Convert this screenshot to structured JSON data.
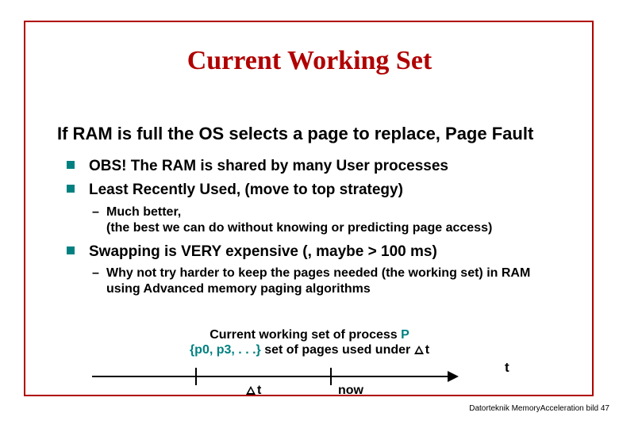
{
  "title": "Current Working Set",
  "intro": "If RAM is full the OS selects a page to replace, Page Fault",
  "bullets": {
    "b1": "OBS! The RAM is shared by many User processes",
    "b2": "Least Recently Used, (move to top strategy)",
    "b2_sub1a": "Much better,",
    "b2_sub1b": "(the best we can do without knowing or predicting page access)",
    "b3": "Swapping is VERY expensive (, maybe > 100 ms)",
    "b3_sub1a": "Why not try harder to keep the pages needed (the working set) in RAM",
    "b3_sub1b": "using Advanced memory paging algorithms"
  },
  "ws": {
    "line1_pre": "Current working set of process ",
    "line1_proc": "P",
    "line2_set": "{p0, p3, . . .}",
    "line2_mid": " set of pages used under ",
    "line2_dt": "t"
  },
  "timeline": {
    "end_label": "t",
    "delta_label": "t",
    "now_label": "now"
  },
  "footer": "Datorteknik MemoryAcceleration bild 47"
}
